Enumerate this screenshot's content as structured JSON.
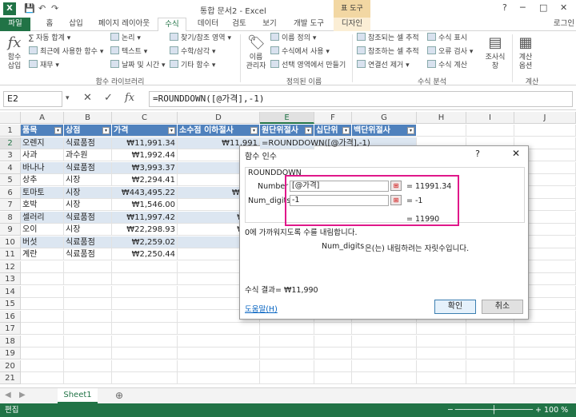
{
  "window": {
    "title": "통합 문서2 - Excel",
    "context_tab_group": "표 도구",
    "sign_in": "로그인",
    "app_icon": "excel-icon"
  },
  "tabs": [
    "파일",
    "홈",
    "삽입",
    "페이지 레이아웃",
    "수식",
    "데이터",
    "검토",
    "보기",
    "개발 도구",
    "디자인"
  ],
  "ribbon": {
    "insert_function": "함수\n삽입",
    "autosum": "자동 합계",
    "recent": "최근에 사용한 함수",
    "finance": "재무",
    "logical": "논리",
    "text": "텍스트",
    "datetime": "날짜 및 시간",
    "lookup": "찾기/참조 영역",
    "math": "수학/삼각",
    "more": "기타 함수",
    "group1": "함수 라이브러리",
    "name_manager": "이름\n관리자",
    "define_name": "이름 정의",
    "use_in_formula": "수식에서 사용",
    "create_from_sel": "선택 영역에서 만들기",
    "group2": "정의된 이름",
    "trace_prec": "참조되는 셀 추적",
    "trace_dep": "참조하는 셀 추적",
    "remove_arrows": "연결선 제거",
    "show_formulas": "수식 표시",
    "error_check": "오류 검사",
    "evaluate": "수식 계산",
    "group3": "수식 분석",
    "watch": "조사식\n창",
    "calc_options": "계산\n옵션",
    "group4": "계산"
  },
  "formula_bar": {
    "name_box": "E2",
    "formula": "=ROUNDDOWN([@가격],-1)"
  },
  "columns": [
    "A",
    "B",
    "C",
    "D",
    "E",
    "F",
    "G",
    "H",
    "I",
    "J"
  ],
  "table": {
    "headers": [
      "품목",
      "상점",
      "가격",
      "소수점 이하절사",
      "원단위절사",
      "십단위",
      "백단위절사"
    ],
    "rows": [
      [
        "오렌지",
        "식료품점",
        "₩11,991.34",
        "₩11,991",
        "=ROUNDDOWN([@가격],-1)"
      ],
      [
        "사과",
        "과수원",
        "₩1,992.44",
        "₩1,"
      ],
      [
        "바나나",
        "식료품점",
        "₩3,993.37",
        "₩3,"
      ],
      [
        "상추",
        "시장",
        "₩2,294.41",
        "₩2,"
      ],
      [
        "토마토",
        "시장",
        "₩443,495.22",
        "₩443,"
      ],
      [
        "호박",
        "시장",
        "₩1,546.00",
        "₩1,"
      ],
      [
        "셀러리",
        "식료품점",
        "₩11,997.42",
        "₩11,"
      ],
      [
        "오이",
        "시장",
        "₩22,298.93",
        "₩22,"
      ],
      [
        "버섯",
        "식료품점",
        "₩2,259.02",
        "₩2,"
      ],
      [
        "계란",
        "식료품점",
        "₩2,250.44",
        "₩2,"
      ]
    ]
  },
  "row_numbers": [
    "1",
    "2",
    "3",
    "4",
    "5",
    "6",
    "7",
    "8",
    "9",
    "10",
    "11",
    "12",
    "13",
    "14",
    "15",
    "16",
    "17",
    "18",
    "19",
    "20",
    "21"
  ],
  "dialog": {
    "title": "함수 인수",
    "help_q": "?",
    "close": "✕",
    "function_name": "ROUNDDOWN",
    "arg1_label": "Number",
    "arg1_value": "[@가격]",
    "arg1_result": "=  11991.34",
    "arg2_label": "Num_digits",
    "arg2_value": "-1",
    "arg2_result": "=  -1",
    "total_result": "=  11990",
    "description": "0에 가까워지도록 수를 내림합니다.",
    "arg_help_name": "Num_digits",
    "arg_help_text": "은(는) 내림하려는 자릿수입니다.",
    "formula_result": "수식 결과=  ₩11,990",
    "help_link": "도움말(H)",
    "ok": "확인",
    "cancel": "취소"
  },
  "sheet": {
    "tab": "Sheet1",
    "add": "⊕"
  },
  "status": {
    "mode": "편집",
    "zoom": "100 %"
  }
}
